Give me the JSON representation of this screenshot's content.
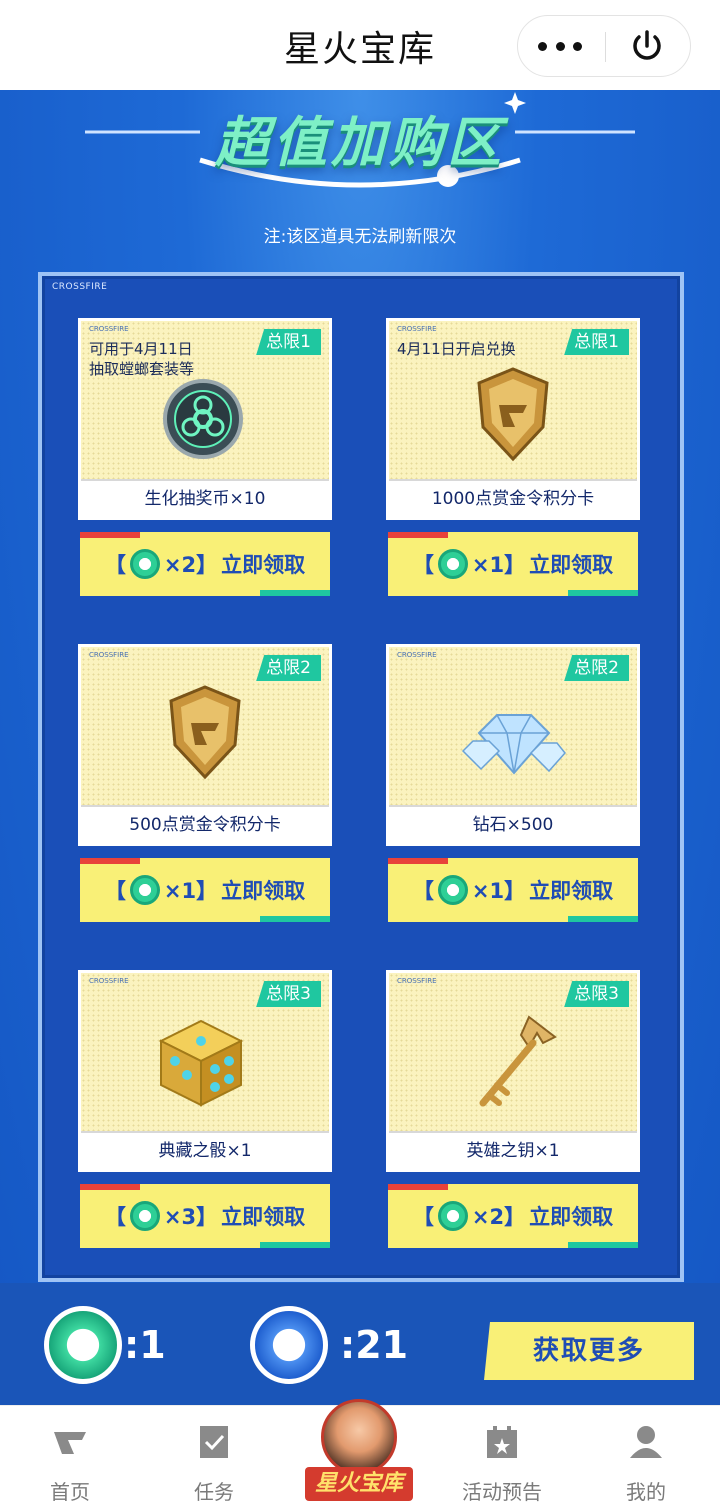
{
  "app": {
    "title": "星火宝库"
  },
  "banner": {
    "title": "超值加购区",
    "note": "注:该区道具无法刷新限次"
  },
  "panel": {
    "brand": "CROSSFIRE"
  },
  "items": [
    {
      "brand": "CROSSFIRE",
      "limit": "总限1",
      "desc_line1": "可用于4月11日",
      "desc_line2": "抽取螳螂套装等",
      "name": "生化抽奖币×10",
      "button": {
        "open": "【",
        "cost": "×2】",
        "action": "立即领取"
      },
      "icon": "biohazard-coin-icon"
    },
    {
      "brand": "CROSSFIRE",
      "limit": "总限1",
      "desc_line1": "4月11日开启兑换",
      "desc_line2": "",
      "name": "1000点赏金令积分卡",
      "button": {
        "open": "【",
        "cost": "×1】",
        "action": "立即领取"
      },
      "icon": "gold-shield-icon"
    },
    {
      "brand": "CROSSFIRE",
      "limit": "总限2",
      "desc_line1": "",
      "desc_line2": "",
      "name": "500点赏金令积分卡",
      "button": {
        "open": "【",
        "cost": "×1】",
        "action": "立即领取"
      },
      "icon": "gold-shield-icon"
    },
    {
      "brand": "CROSSFIRE",
      "limit": "总限2",
      "desc_line1": "",
      "desc_line2": "",
      "name": "钻石×500",
      "button": {
        "open": "【",
        "cost": "×1】",
        "action": "立即领取"
      },
      "icon": "diamond-icon"
    },
    {
      "brand": "CROSSFIRE",
      "limit": "总限3",
      "desc_line1": "",
      "desc_line2": "",
      "name": "典藏之骰×1",
      "button": {
        "open": "【",
        "cost": "×3】",
        "action": "立即领取"
      },
      "icon": "dice-icon"
    },
    {
      "brand": "CROSSFIRE",
      "limit": "总限3",
      "desc_line1": "",
      "desc_line2": "",
      "name": "英雄之钥×1",
      "button": {
        "open": "【",
        "cost": "×2】",
        "action": "立即领取"
      },
      "icon": "key-icon"
    }
  ],
  "currency": {
    "green_value": ":1",
    "blue_value": ":21",
    "get_more": "获取更多"
  },
  "tabs": [
    {
      "label": "首页",
      "icon": "cf-logo-icon"
    },
    {
      "label": "任务",
      "icon": "task-icon"
    },
    {
      "label": "星火宝库",
      "icon": "avatar-icon"
    },
    {
      "label": "活动预告",
      "icon": "calendar-icon"
    },
    {
      "label": "我的",
      "icon": "user-icon"
    }
  ],
  "colors": {
    "primary_blue": "#1e6ad6",
    "accent_green": "#1fc7a0",
    "button_yellow": "#f9f077",
    "card_bg": "#fbf3bf"
  }
}
